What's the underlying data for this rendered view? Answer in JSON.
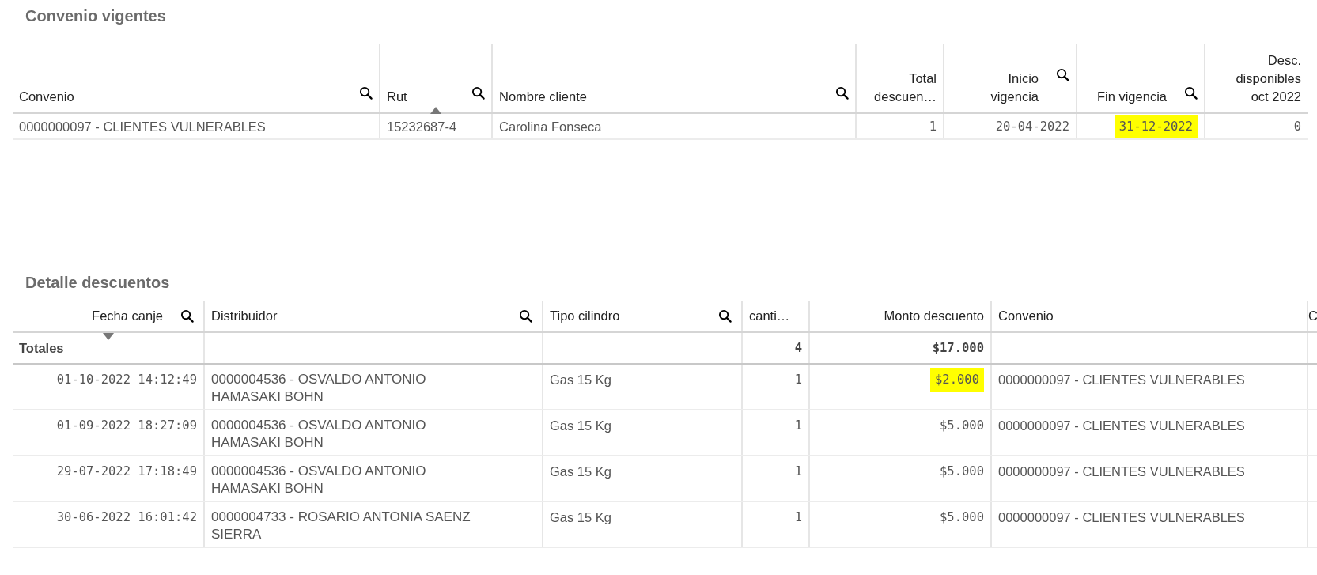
{
  "sections": [
    {
      "title": "Convenio vigentes",
      "columns": [
        {
          "label": "Convenio",
          "kind": "text",
          "searchable": true,
          "sorted_up": false,
          "sorted_down": false
        },
        {
          "label": "Rut",
          "kind": "text",
          "searchable": true,
          "sorted_up": true,
          "sorted_down": false
        },
        {
          "label": "Nombre cliente",
          "kind": "text",
          "searchable": true,
          "sorted_up": false,
          "sorted_down": false
        },
        {
          "label": "Total descuen…",
          "kind": "number",
          "searchable": false,
          "sorted_up": false,
          "sorted_down": false
        },
        {
          "label": "Inicio vigencia",
          "kind": "number",
          "searchable": true,
          "sorted_up": false,
          "sorted_down": false
        },
        {
          "label": "Fin vigencia",
          "kind": "number",
          "searchable": true,
          "sorted_up": false,
          "sorted_down": false
        },
        {
          "label": "Desc. disponibles oct 2022",
          "kind": "number",
          "searchable": false,
          "sorted_up": false,
          "sorted_down": false
        }
      ],
      "rows": [
        {
          "cells": [
            {
              "text": "0000000097 - CLIENTES VULNERABLES",
              "highlighted": false
            },
            {
              "text": "15232687-4",
              "highlighted": false
            },
            {
              "text": "Carolina Fonseca",
              "highlighted": false
            },
            {
              "text": "1",
              "highlighted": false
            },
            {
              "text": "20-04-2022",
              "highlighted": false
            },
            {
              "text": "31-12-2022",
              "highlighted": true
            },
            {
              "text": "0",
              "highlighted": false
            }
          ]
        }
      ]
    },
    {
      "title": "Detalle descuentos",
      "totals_label": "Totales",
      "columns": [
        {
          "label": "Fecha canje",
          "kind": "number",
          "searchable": true,
          "sorted_up": false,
          "sorted_down": true
        },
        {
          "label": "Distribuidor",
          "kind": "text",
          "searchable": true,
          "sorted_up": false,
          "sorted_down": false
        },
        {
          "label": "Tipo cilindro",
          "kind": "text",
          "searchable": true,
          "sorted_up": false,
          "sorted_down": false
        },
        {
          "label": "canti…",
          "kind": "count",
          "searchable": false,
          "sorted_up": false,
          "sorted_down": false,
          "total": "4"
        },
        {
          "label": "Monto descuento",
          "kind": "number",
          "searchable": false,
          "sorted_up": false,
          "sorted_down": false,
          "total": "$17.000"
        },
        {
          "label": "Convenio",
          "kind": "text",
          "searchable": false,
          "sorted_up": false,
          "sorted_down": false
        },
        {
          "label": "C",
          "kind": "text",
          "searchable": false,
          "sorted_up": false,
          "sorted_down": false
        }
      ],
      "rows": [
        {
          "cells": [
            {
              "text": "01-10-2022 14:12:49",
              "highlighted": false
            },
            {
              "text": "0000004536 - OSVALDO ANTONIO HAMASAKI BOHN",
              "highlighted": false
            },
            {
              "text": "Gas 15 Kg",
              "highlighted": false
            },
            {
              "text": "1",
              "highlighted": false
            },
            {
              "text": "$2.000",
              "highlighted": true
            },
            {
              "text": "0000000097 - CLIENTES VULNERABLES",
              "highlighted": false
            }
          ]
        },
        {
          "cells": [
            {
              "text": "01-09-2022 18:27:09",
              "highlighted": false
            },
            {
              "text": "0000004536 - OSVALDO ANTONIO HAMASAKI BOHN",
              "highlighted": false
            },
            {
              "text": "Gas 15 Kg",
              "highlighted": false
            },
            {
              "text": "1",
              "highlighted": false
            },
            {
              "text": "$5.000",
              "highlighted": false
            },
            {
              "text": "0000000097 - CLIENTES VULNERABLES",
              "highlighted": false
            }
          ]
        },
        {
          "cells": [
            {
              "text": "29-07-2022 17:18:49",
              "highlighted": false
            },
            {
              "text": "0000004536 - OSVALDO ANTONIO HAMASAKI BOHN",
              "highlighted": false
            },
            {
              "text": "Gas 15 Kg",
              "highlighted": false
            },
            {
              "text": "1",
              "highlighted": false
            },
            {
              "text": "$5.000",
              "highlighted": false
            },
            {
              "text": "0000000097 - CLIENTES VULNERABLES",
              "highlighted": false
            }
          ]
        },
        {
          "cells": [
            {
              "text": "30-06-2022 16:01:42",
              "highlighted": false
            },
            {
              "text": "0000004733 - ROSARIO ANTONIA SAENZ SIERRA",
              "highlighted": false
            },
            {
              "text": "Gas 15 Kg",
              "highlighted": false
            },
            {
              "text": "1",
              "highlighted": false
            },
            {
              "text": "$5.000",
              "highlighted": false
            },
            {
              "text": "0000000097 - CLIENTES VULNERABLES",
              "highlighted": false
            }
          ]
        }
      ]
    }
  ]
}
